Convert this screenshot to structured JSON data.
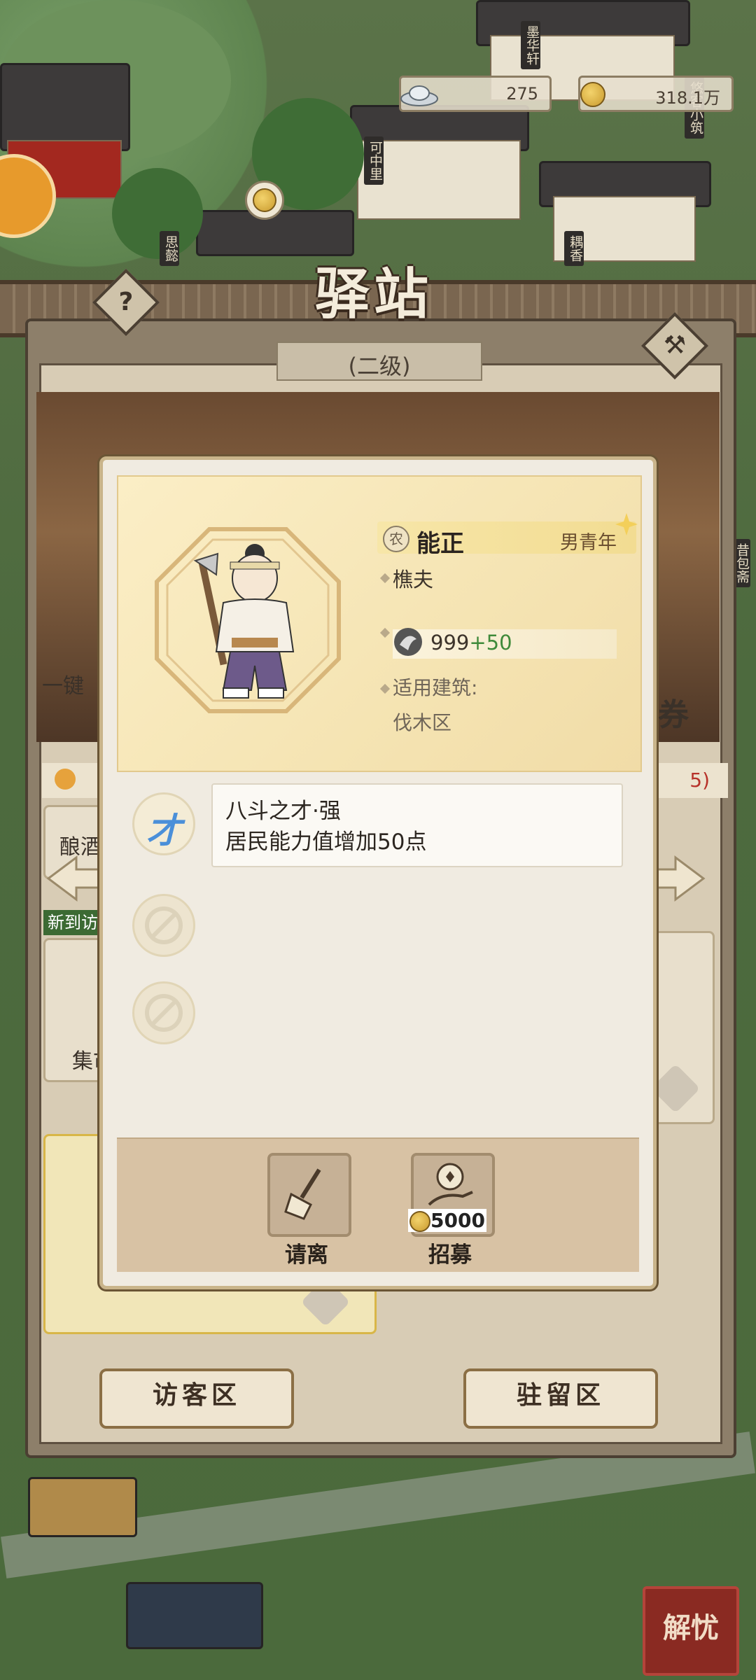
{
  "resources": {
    "silver": "275",
    "coins": "318.1万"
  },
  "map_signs": [
    "墨华轩",
    "可中里",
    "悠客小筑",
    "思懿",
    "耦香",
    "昔包斋"
  ],
  "station": {
    "title": "驿站",
    "level": "(二级)",
    "help_icon": "question-icon",
    "hammer_icon": "hammer-icon",
    "tabs": {
      "visitor": "访客区",
      "resident": "驻留区"
    },
    "bg_list": {
      "row1_label": "酿酒",
      "row2_badge": "新到访",
      "row2_label": "集市",
      "count_suffix": "5)"
    }
  },
  "resident": {
    "type_badge": "农",
    "name": "能正",
    "gender_age": "男青年",
    "profession": "樵夫",
    "power_base": "999",
    "power_bonus": "+50",
    "building_label": "适用建筑:",
    "building_value": "伐木区"
  },
  "skill": {
    "icon_char": "才",
    "title": "八斗之才·强",
    "desc": "居民能力值增加50点"
  },
  "actions": {
    "dismiss": "请离",
    "recruit": "招募",
    "recruit_cost": "5000"
  },
  "corner_button": "解忧",
  "right_label": "券",
  "left_label": "一键"
}
